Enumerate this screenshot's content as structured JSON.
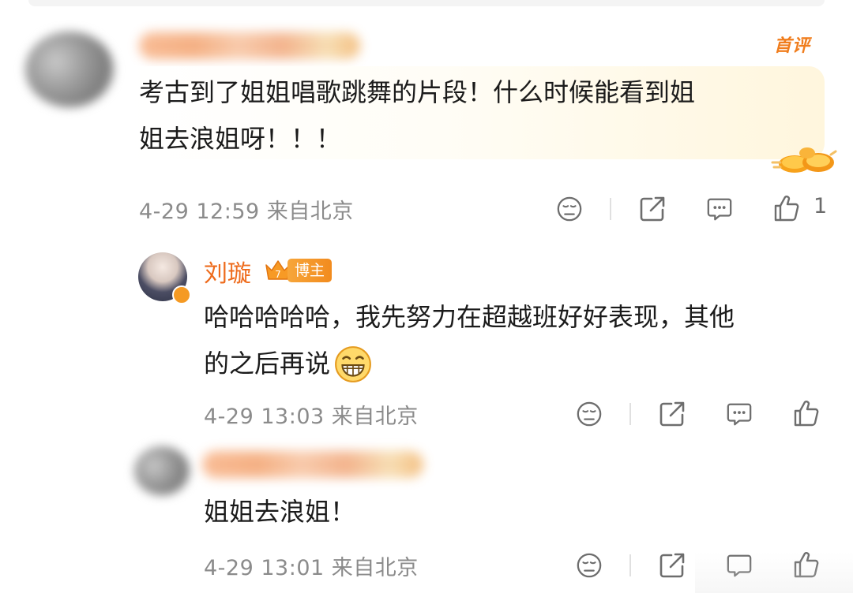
{
  "comments": [
    {
      "text": "考古到了姐姐唱歌跳舞的片段！什么时候能看到姐",
      "text_line2": "姐去浪姐呀！！！",
      "badge": "首评",
      "meta": "4-29 12:59 来自北京",
      "like_count": "1"
    }
  ],
  "reply_blogger": {
    "name": "刘璇",
    "level": "7",
    "tag": "博主",
    "text_line1": "哈哈哈哈哈，我先努力在超越班好好表现，其他",
    "text_line2": "的之后再说",
    "emoji": "grinning-face",
    "meta": "4-29 13:03 来自北京"
  },
  "reply_user": {
    "text": "姐姐去浪姐！",
    "meta": "4-29 13:01 来自北京"
  },
  "colors": {
    "accent": "#f07d1d",
    "meta_gray": "#8b8b8b",
    "blogger_name": "#ee6b1c"
  }
}
